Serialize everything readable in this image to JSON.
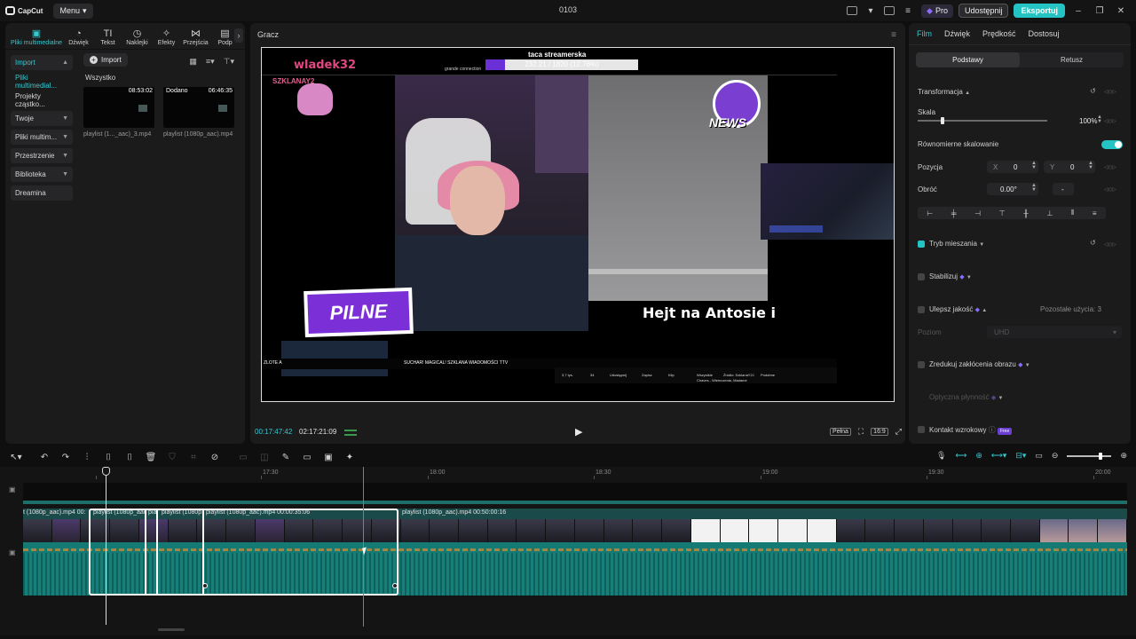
{
  "app": {
    "logo_text": "CapCut",
    "menu_label": "Menu",
    "title": "0103",
    "pro_label": "Pro",
    "share_label": "Udostępnij",
    "export_label": "Eksportuj"
  },
  "tool_tabs": [
    {
      "label": "Pliki multimedialne",
      "icon": "media-icon"
    },
    {
      "label": "Dźwięk",
      "icon": "audio-icon"
    },
    {
      "label": "Tekst",
      "icon": "text-icon"
    },
    {
      "label": "Naklejki",
      "icon": "sticker-icon"
    },
    {
      "label": "Efekty",
      "icon": "effects-icon"
    },
    {
      "label": "Przejścia",
      "icon": "transitions-icon"
    },
    {
      "label": "Podp",
      "icon": "captions-icon"
    }
  ],
  "side_nav": [
    {
      "label": "Import",
      "chev": "▲"
    },
    {
      "label": "Pliki multimedial...",
      "chev": ""
    },
    {
      "label": "Projekty cząstko...",
      "chev": ""
    },
    {
      "label": "Twoje",
      "chev": "▼"
    },
    {
      "label": "Pliki multim...",
      "chev": "▼"
    },
    {
      "label": "Przestrzenie",
      "chev": "▼"
    },
    {
      "label": "Biblioteka",
      "chev": "▼"
    },
    {
      "label": "Dreamina",
      "chev": ""
    }
  ],
  "media": {
    "import_label": "Import",
    "all_label": "Wszystko",
    "items": [
      {
        "name": "playlist (1..._aac)_3.mp4",
        "duration": "08:53:02",
        "added": ""
      },
      {
        "name": "playlist (1080p_aac).mp4",
        "duration": "06:46:35",
        "added": "Dodano"
      }
    ]
  },
  "player": {
    "title": "Gracz",
    "current_time": "00:17:47:42",
    "total_time": "02:17:21:09",
    "full_label": "Pełna",
    "ratio_label": "16:9",
    "stream_title": "taca streamerska",
    "stream_progress_text": "232.21 / 1820 (12.76%)",
    "stream_progress": 0.1276,
    "channel_name": "wladek32",
    "szklana": "SZKLANAY2",
    "grande": "grande connection",
    "news_label": "NEWS",
    "overlay_text": "Hejt na Antosie i",
    "pilne_label": "PILNE",
    "ticker_left": "ZLOTE A",
    "ticker_right": "SUCHAR! MAGICAL! SZKLANA WIADOMOŚCI TTV",
    "yt_items": [
      "3,7 tys.",
      "34",
      "Udostępnij",
      "Zapisz",
      "Klip",
      "Wszystkie",
      "Źródło: SzklanaY2J",
      "Podobne"
    ],
    "yt_subtitle": "Chaves - Wiemczenia, Madame"
  },
  "inspector": {
    "tabs": [
      "Film",
      "Dźwięk",
      "Prędkość",
      "Dostosuj"
    ],
    "segments": [
      "Podstawy",
      "Retusz"
    ],
    "transform_label": "Transformacja",
    "scale_label": "Skala",
    "scale_value": "100%",
    "scale_fraction": 0.18,
    "uniform_label": "Równomierne skalowanie",
    "position_label": "Pozycja",
    "x_label": "X",
    "x_value": "0",
    "y_label": "Y",
    "y_value": "0",
    "rotate_label": "Obróć",
    "rotate_value": "0.00°",
    "rotate_dash": "-",
    "blend_label": "Tryb mieszania",
    "stabilize_label": "Stabilizuj",
    "enhance_label": "Ulepsz jakość",
    "remaining_label": "Pozostałe użycia: 3",
    "level_label": "Poziom",
    "level_value": "UHD",
    "noise_label": "Zredukuj zakłócenia obrazu",
    "optical_label": "Optyczna płynność",
    "eye_label": "Kontakt wzrokowy",
    "free_label": "Free"
  },
  "timeline": {
    "ruler": [
      "17:30",
      "18:00",
      "18:30",
      "19:00",
      "19:30",
      "20:00"
    ],
    "clips": [
      {
        "label": "t (1080p_aac).mp4   00:"
      },
      {
        "label": "playlist (1080p_aac"
      },
      {
        "label": "pla"
      },
      {
        "label": "playlist (1080p"
      },
      {
        "label": "playlist (1080p_aac).mp4   00:00:35:06"
      },
      {
        "label": "playlist (1080p_aac).mp4   00:50:00:16"
      }
    ]
  },
  "colors": {
    "accent": "#24c4c4",
    "track_teal": "#157a74",
    "brand_purple": "#7b2fd6"
  }
}
